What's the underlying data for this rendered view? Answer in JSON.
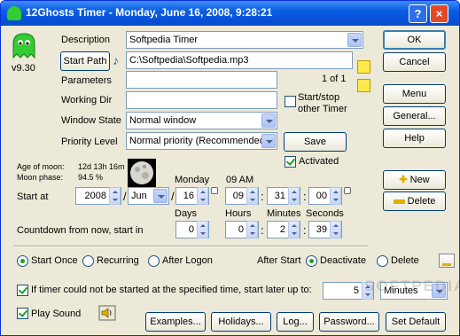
{
  "window": {
    "title": "12Ghosts Timer  -  Monday, June 16, 2008, 9:28:21",
    "help_label": "?",
    "close_label": "×"
  },
  "app": {
    "version": "v9.30"
  },
  "fields": {
    "description_label": "Description",
    "description_value": "Softpedia Timer",
    "start_path_label": "Start Path",
    "start_path_value": "C:\\Softpedia\\Softpedia.mp3",
    "page_counter": "1 of 1",
    "parameters_label": "Parameters",
    "parameters_value": "",
    "working_dir_label": "Working Dir",
    "working_dir_value": "",
    "window_state_label": "Window State",
    "window_state_value": "Normal window",
    "priority_label": "Priority Level",
    "priority_value": "Normal priority (Recommended",
    "startstop_label_1": "Start/stop",
    "startstop_label_2": "other Timer",
    "save_label": "Save",
    "activated_label": "Activated"
  },
  "moon": {
    "age_label": "Age of moon:",
    "age_value": "12d 13h 16m",
    "phase_label": "Moon phase:",
    "phase_value": "94.5 %"
  },
  "start_at": {
    "label": "Start at",
    "weekday": "Monday",
    "hour_header": "09 AM",
    "year": "2008",
    "slash1": "/",
    "month": "Jun",
    "slash2": "/",
    "day": "16",
    "hour": "09",
    "colon1": ":",
    "minute": "31",
    "colon2": ":",
    "second": "00"
  },
  "countdown": {
    "label": "Countdown from now, start in",
    "days_label": "Days",
    "hours_label": "Hours",
    "minutes_label": "Minutes",
    "seconds_label": "Seconds",
    "days": "0",
    "hours": "0",
    "colon1": ":",
    "minutes": "2",
    "colon2": ":",
    "seconds": "39"
  },
  "right_buttons": {
    "ok": "OK",
    "cancel": "Cancel",
    "menu": "Menu",
    "general": "General...",
    "help": "Help",
    "new": "New",
    "delete": "Delete"
  },
  "mode": {
    "start_once": "Start Once",
    "recurring": "Recurring",
    "after_logon": "After Logon",
    "after_start_label": "After Start",
    "deactivate": "Deactivate",
    "delete": "Delete"
  },
  "later": {
    "label": "If timer could not be started at the specified time, start later up to:",
    "value": "5",
    "unit": "Minutes"
  },
  "sound": {
    "label": "Play Sound"
  },
  "bottom_buttons": {
    "examples": "Examples...",
    "holidays": "Holidays...",
    "log": "Log...",
    "password": "Password...",
    "set_default": "Set Default"
  },
  "watermark": "SOFTPEDIA",
  "colors": {
    "titlebar": "#0a5ee4",
    "window_bg": "#ece9d8",
    "check_green": "#21a121",
    "ghost_green": "#33cc33"
  }
}
